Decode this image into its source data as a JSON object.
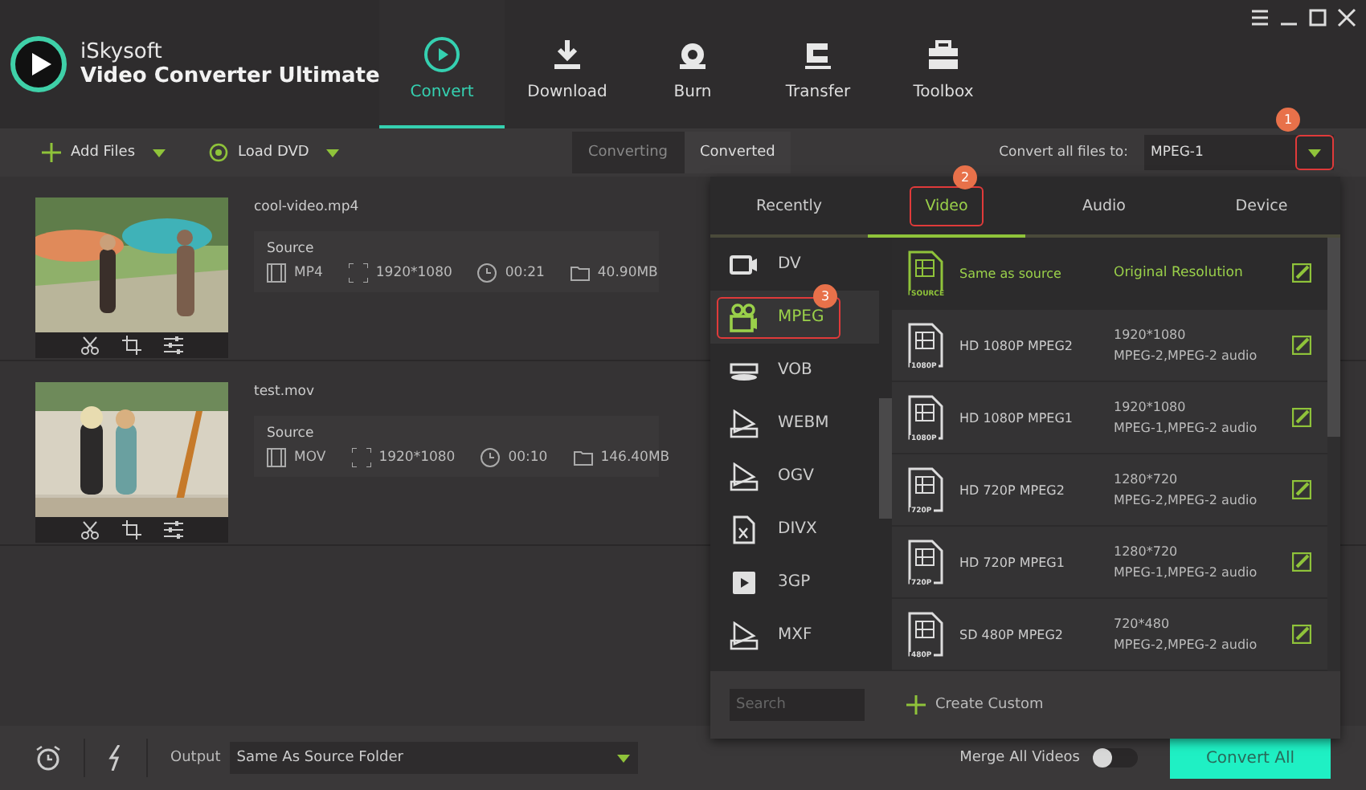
{
  "app": {
    "brand": "iSkysoft",
    "product": "Video Converter Ultimate"
  },
  "nav": [
    {
      "label": "Convert",
      "selected": true
    },
    {
      "label": "Download",
      "selected": false
    },
    {
      "label": "Burn",
      "selected": false
    },
    {
      "label": "Transfer",
      "selected": false
    },
    {
      "label": "Toolbox",
      "selected": false
    }
  ],
  "toolbar": {
    "add_files": "Add Files",
    "load_dvd": "Load DVD",
    "view_tabs": [
      {
        "label": "Converting",
        "selected": false
      },
      {
        "label": "Converted",
        "selected": true
      }
    ],
    "convert_all_label": "Convert all files to:",
    "format": "MPEG-1",
    "format_callout": "1"
  },
  "files": [
    {
      "name": "cool-video.mp4",
      "source_label": "Source",
      "format": "MP4",
      "resolution": "1920*1080",
      "duration": "00:21",
      "size": "40.90MB"
    },
    {
      "name": "test.mov",
      "source_label": "Source",
      "format": "MOV",
      "resolution": "1920*1080",
      "duration": "00:10",
      "size": "146.40MB"
    }
  ],
  "format_popup": {
    "tabs": [
      {
        "label": "Recently",
        "selected": false
      },
      {
        "label": "Video",
        "selected": true,
        "callout": "2"
      },
      {
        "label": "Audio",
        "selected": false
      },
      {
        "label": "Device",
        "selected": false
      }
    ],
    "categories": [
      {
        "label": "DV",
        "selected": false
      },
      {
        "label": "MPEG",
        "selected": true,
        "callout": "3"
      },
      {
        "label": "VOB",
        "selected": false
      },
      {
        "label": "WEBM",
        "selected": false
      },
      {
        "label": "OGV",
        "selected": false
      },
      {
        "label": "DIVX",
        "selected": false
      },
      {
        "label": "3GP",
        "selected": false
      },
      {
        "label": "MXF",
        "selected": false
      }
    ],
    "presets": [
      {
        "kind": "source",
        "name": "Same as source",
        "badge": "SOURCE",
        "detail_1": "Original Resolution"
      },
      {
        "kind": "preset",
        "name": "HD 1080P MPEG2",
        "badge": "1080P",
        "detail_1": "1920*1080",
        "detail_2": "MPEG-2,MPEG-2 audio"
      },
      {
        "kind": "preset",
        "name": "HD 1080P MPEG1",
        "badge": "1080P",
        "detail_1": "1920*1080",
        "detail_2": "MPEG-1,MPEG-2 audio"
      },
      {
        "kind": "preset",
        "name": "HD 720P MPEG2",
        "badge": "720P",
        "detail_1": "1280*720",
        "detail_2": "MPEG-2,MPEG-2 audio"
      },
      {
        "kind": "preset",
        "name": "HD 720P MPEG1",
        "badge": "720P",
        "detail_1": "1280*720",
        "detail_2": "MPEG-1,MPEG-2 audio"
      },
      {
        "kind": "preset",
        "name": "SD 480P MPEG2",
        "badge": "480P",
        "detail_1": "720*480",
        "detail_2": "MPEG-2,MPEG-2 audio"
      }
    ],
    "search": {
      "placeholder": "Search"
    },
    "create_custom": "Create Custom"
  },
  "bottom": {
    "output_label": "Output",
    "output_value": "Same As Source Folder",
    "merge_label": "Merge All Videos",
    "merge_on": false,
    "convert_all": "Convert All"
  }
}
